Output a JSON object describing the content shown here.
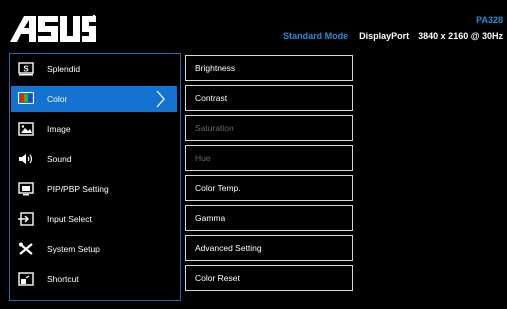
{
  "header": {
    "logo_text": "ASUS",
    "model": "PA328",
    "mode": "Standard Mode",
    "input": "DisplayPort",
    "resolution": "3840 x 2160 @ 30Hz"
  },
  "main_menu": {
    "items": [
      {
        "label": "Splendid",
        "icon": "splendid-icon"
      },
      {
        "label": "Color",
        "icon": "color-icon",
        "selected": true
      },
      {
        "label": "Image",
        "icon": "image-icon"
      },
      {
        "label": "Sound",
        "icon": "speaker-icon"
      },
      {
        "label": "PIP/PBP Setting",
        "icon": "pip-icon"
      },
      {
        "label": "Input Select",
        "icon": "input-icon"
      },
      {
        "label": "System Setup",
        "icon": "tools-icon"
      },
      {
        "label": "Shortcut",
        "icon": "shortcut-icon"
      }
    ]
  },
  "sub_menu": {
    "items": [
      {
        "label": "Brightness",
        "enabled": true
      },
      {
        "label": "Contrast",
        "enabled": true
      },
      {
        "label": "Saturation",
        "enabled": false
      },
      {
        "label": "Hue",
        "enabled": false
      },
      {
        "label": "Color Temp.",
        "enabled": true
      },
      {
        "label": "Gamma",
        "enabled": true
      },
      {
        "label": "Advanced Setting",
        "enabled": true
      },
      {
        "label": "Color Reset",
        "enabled": true
      }
    ]
  },
  "colors": {
    "accent": "#1473d0",
    "text_accent": "#2a8fd8",
    "dim": "#6a6a6a"
  }
}
